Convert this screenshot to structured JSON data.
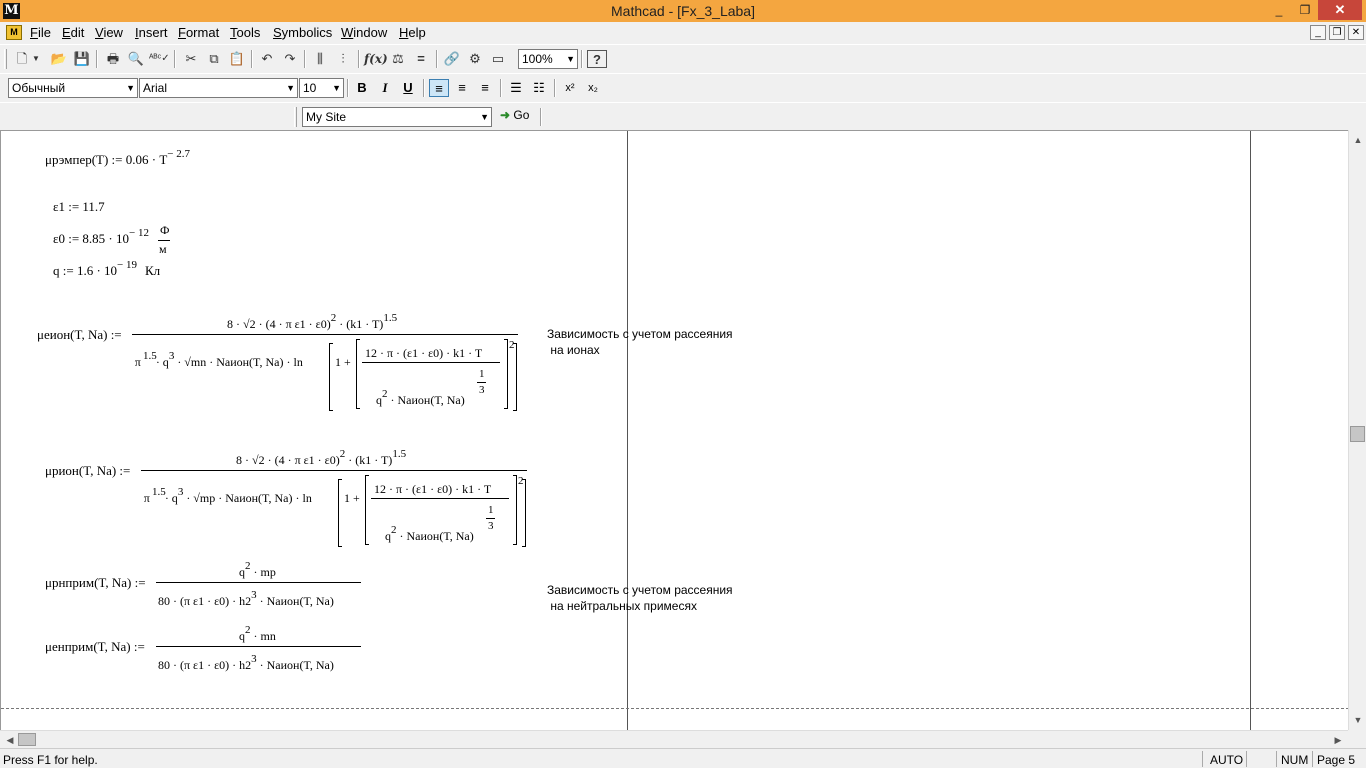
{
  "window": {
    "title": "Mathcad - [Fx_3_Laba]",
    "logo": "M",
    "minimize": "_",
    "maximize": "❐",
    "close": "✕"
  },
  "menu": [
    "File",
    "Edit",
    "View",
    "Insert",
    "Format",
    "Tools",
    "Symbolics",
    "Window",
    "Help"
  ],
  "toolbar": {
    "zoom": "100%",
    "style": "Обычный",
    "font": "Arial",
    "font_size": "10",
    "bold": "B",
    "italic": "I",
    "underline": "U",
    "superscript": "x²",
    "subscript": "x₂",
    "url": "My Site",
    "go": "Go"
  },
  "worksheet": {
    "mu_remper": "μрэмпер(T) := 0.06 · T",
    "mu_remper_exp": "− 2.7",
    "eps1": "ε1 := 11.7",
    "eps0": "ε0 := 8.85 · 10",
    "eps0_exp": "− 12",
    "eps0_unit_num": "Ф",
    "eps0_unit_den": "м",
    "q": "q := 1.6 · 10",
    "q_exp": "− 19",
    "q_unit": "Кл",
    "mu_eion_lhs": "μеион(T, Na) :=",
    "mu_eion_num": "8 · √2 · (4 · π ε1 · ε0)",
    "mu_eion_num_sq": "2",
    "mu_eion_num_tail": " · (k1 · T)",
    "mu_eion_num_pow": "1.5",
    "mu_eion_den_a": "π",
    "mu_eion_den_a_pow": "1.5",
    "mu_eion_den_b": " · q",
    "mu_eion_den_b_pow": "3",
    "mu_eion_den_c": " · √mn · Naион(T, Na) · ln",
    "mu_eion_one": "1 +",
    "mu_eion_inner_num": "12 · π · (ε1 · ε0) · k1 · T",
    "mu_eion_inner_den": "q",
    "mu_eion_inner_den_pow": "2",
    "mu_eion_inner_den_tail": " · Naион(T, Na)",
    "third_num": "1",
    "third_den": "3",
    "square": "2",
    "comment_ions": "Зависимость с учетом рассеяния\n на ионах",
    "mu_pion_lhs": "μрион(T, Na) :=",
    "mu_pion_num": "8 · √2 · (4 · π ε1 · ε0)",
    "mu_pion_num_sq": "2",
    "mu_pion_num_tail": " · (k1 · T)",
    "mu_pion_num_pow": "1.5",
    "mu_pion_den_a": "π",
    "mu_pion_den_a_pow": "1.5",
    "mu_pion_den_b": " · q",
    "mu_pion_den_b_pow": "3",
    "mu_pion_den_c": " · √mp · Naион(T, Na) · ln",
    "mu_pion_one": "1 +",
    "mu_pion_inner_num": "12 · π · (ε1 · ε0) · k1 · T",
    "mu_pion_inner_den": "q",
    "mu_pion_inner_den_pow": "2",
    "mu_pion_inner_den_tail": " · Naион(T, Na)",
    "mu_pnprim_lhs": "μрнприм(T, Na) :=",
    "mu_pnprim_num": "q",
    "mu_pnprim_num_pow": "2",
    "mu_pnprim_num_tail": " · mp",
    "mu_pnprim_den": "80 · (π ε1 · ε0) · h2",
    "mu_pnprim_den_pow": "3",
    "mu_pnprim_den_tail": " · Naион(T, Na)",
    "comment_neutral": "Зависимость с учетом рассеяния\n на нейтральных примесях",
    "mu_enprim_lhs": "μенприм(T, Na) :=",
    "mu_enprim_num": "q",
    "mu_enprim_num_pow": "2",
    "mu_enprim_num_tail": " · mn",
    "mu_enprim_den": "80 · (π ε1 · ε0) · h2",
    "mu_enprim_den_pow": "3",
    "mu_enprim_den_tail": " · Naион(T, Na)"
  },
  "status": {
    "help": "Press F1 for help.",
    "mode": "AUTO",
    "num": "NUM",
    "page": "Page 5"
  }
}
